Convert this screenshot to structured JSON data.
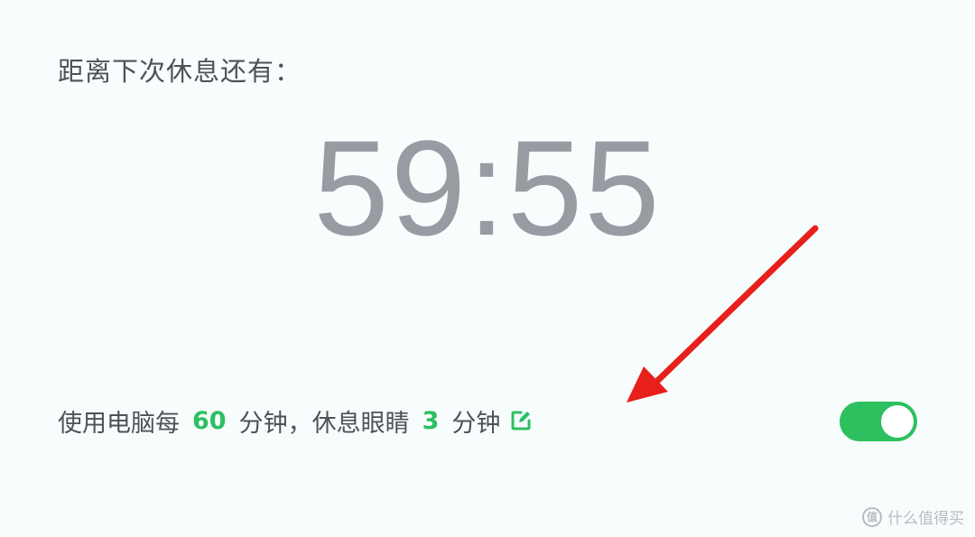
{
  "header": {
    "label": "距离下次休息还有："
  },
  "timer": {
    "remaining": "59:55"
  },
  "settings": {
    "prefix": "使用电脑每",
    "work_minutes": "60",
    "middle": "分钟，休息眼睛",
    "rest_minutes": "3",
    "suffix": "分钟",
    "edit_icon": "edit-icon",
    "toggle_on": true
  },
  "colors": {
    "accent": "#2cbf63",
    "annotation_arrow": "#e8201c"
  },
  "watermark": {
    "badge": "值",
    "text": "什么值得买"
  }
}
